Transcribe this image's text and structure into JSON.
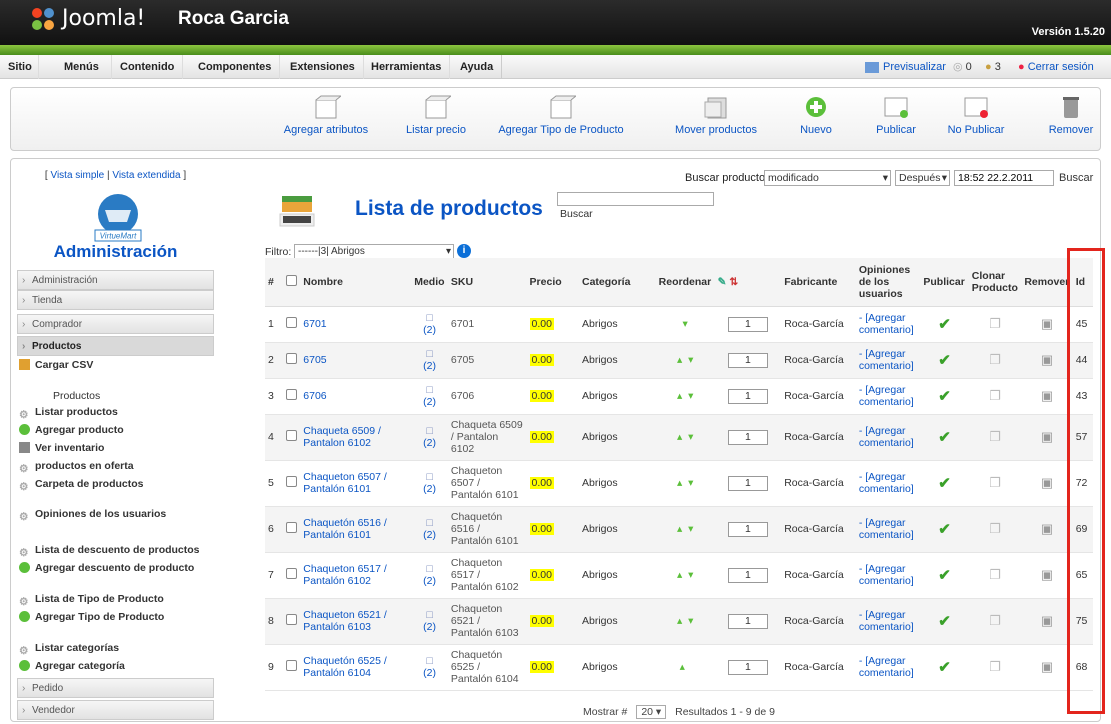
{
  "header": {
    "brand": "Joomla!",
    "site": "Roca Garcia",
    "version": "Versión 1.5.20"
  },
  "menu": [
    "Sitio",
    "Menús",
    "Contenido",
    "Componentes",
    "Extensiones",
    "Herramientas",
    "Ayuda"
  ],
  "menu_right": {
    "preview": "Previsualizar",
    "msgs": "0",
    "users": "3",
    "logout": "Cerrar sesión"
  },
  "toolbar": [
    "Agregar atributos",
    "Listar precio",
    "Agregar Tipo de Producto",
    "Mover productos",
    "Nuevo",
    "Publicar",
    "No Publicar",
    "Remover"
  ],
  "sidebar": {
    "simple": "Vista simple",
    "extended": "Vista extendida",
    "logo_text": "VirtueMart",
    "title": "Administración",
    "sections": [
      "Administración",
      "Tienda",
      "Comprador",
      "Productos"
    ],
    "links": [
      "Cargar CSV",
      "Productos",
      "Listar productos",
      "Agregar producto",
      "Ver inventario",
      "productos en oferta",
      "Carpeta de productos",
      "Opiniones de los usuarios",
      "Lista de descuento de productos",
      "Agregar descuento de producto",
      "Lista de Tipo de Producto",
      "Agregar Tipo de Producto",
      "Listar categorías",
      "Agregar categoría"
    ],
    "bottom_sections": [
      "Pedido",
      "Vendedor"
    ]
  },
  "search": {
    "label": "Buscar producto",
    "field": "modificado",
    "when": "Después",
    "date": "18:52 22.2.2011",
    "btn": "Buscar",
    "btn2": "Buscar"
  },
  "page_title": "Lista de productos",
  "filter": {
    "label": "Filtro:",
    "value": "------|3| Abrigos"
  },
  "columns": [
    "#",
    "Nombre",
    "Medio",
    "SKU",
    "Precio",
    "Categoría",
    "Reordenar",
    "Fabricante",
    "Opiniones de los usuarios",
    "Publicar",
    "Clonar Producto",
    "Remover",
    "Id"
  ],
  "rows": [
    {
      "n": "1",
      "name": "6701",
      "medio": "(2)",
      "sku": "6701",
      "price": "0.00",
      "cat": "Abrigos",
      "ord": "1",
      "fab": "Roca-García",
      "op": "- [Agregar comentario]",
      "id": "45"
    },
    {
      "n": "2",
      "name": "6705",
      "medio": "(2)",
      "sku": "6705",
      "price": "0.00",
      "cat": "Abrigos",
      "ord": "1",
      "fab": "Roca-García",
      "op": "- [Agregar comentario]",
      "id": "44"
    },
    {
      "n": "3",
      "name": "6706",
      "medio": "(2)",
      "sku": "6706",
      "price": "0.00",
      "cat": "Abrigos",
      "ord": "1",
      "fab": "Roca-García",
      "op": "- [Agregar comentario]",
      "id": "43"
    },
    {
      "n": "4",
      "name": "Chaqueta 6509 / Pantalon 6102",
      "medio": "(2)",
      "sku": "Chaqueta 6509 / Pantalon 6102",
      "price": "0.00",
      "cat": "Abrigos",
      "ord": "1",
      "fab": "Roca-García",
      "op": "- [Agregar comentario]",
      "id": "57"
    },
    {
      "n": "5",
      "name": "Chaqueton 6507 / Pantalón 6101",
      "medio": "(2)",
      "sku": "Chaqueton 6507 / Pantalón 6101",
      "price": "0.00",
      "cat": "Abrigos",
      "ord": "1",
      "fab": "Roca-García",
      "op": "- [Agregar comentario]",
      "id": "72"
    },
    {
      "n": "6",
      "name": "Chaquetón 6516 / Pantalón 6101",
      "medio": "(2)",
      "sku": "Chaquetón 6516 / Pantalón 6101",
      "price": "0.00",
      "cat": "Abrigos",
      "ord": "1",
      "fab": "Roca-García",
      "op": "- [Agregar comentario]",
      "id": "69"
    },
    {
      "n": "7",
      "name": "Chaqueton 6517 / Pantalón 6102",
      "medio": "(2)",
      "sku": "Chaqueton 6517 / Pantalón 6102",
      "price": "0.00",
      "cat": "Abrigos",
      "ord": "1",
      "fab": "Roca-García",
      "op": "- [Agregar comentario]",
      "id": "65"
    },
    {
      "n": "8",
      "name": "Chaqueton 6521 / Pantalón 6103",
      "medio": "(2)",
      "sku": "Chaqueton 6521 / Pantalón 6103",
      "price": "0.00",
      "cat": "Abrigos",
      "ord": "1",
      "fab": "Roca-García",
      "op": "- [Agregar comentario]",
      "id": "75"
    },
    {
      "n": "9",
      "name": "Chaquetón 6525 / Pantalón 6104",
      "medio": "(2)",
      "sku": "Chaquetón 6525 / Pantalón 6104",
      "price": "0.00",
      "cat": "Abrigos",
      "ord": "1",
      "fab": "Roca-García",
      "op": "- [Agregar comentario]",
      "id": "68"
    }
  ],
  "footer": {
    "show": "Mostrar #",
    "per": "20",
    "results": "Resultados 1 - 9 de 9"
  }
}
